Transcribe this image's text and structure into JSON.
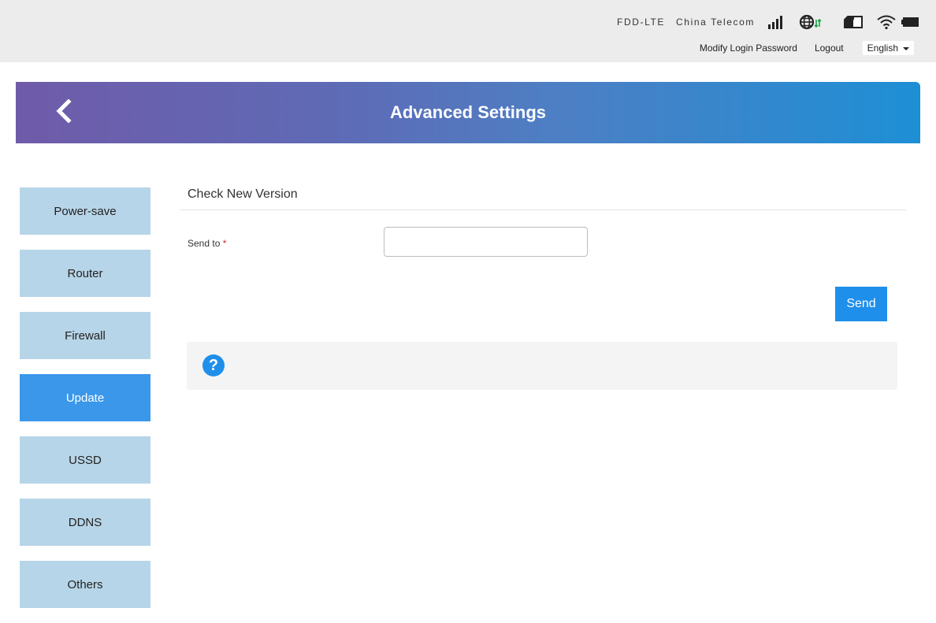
{
  "status": {
    "network_type": "FDD-LTE",
    "carrier": "China Telecom",
    "icons": [
      "signal-bars-icon",
      "globe-data-icon",
      "sim-card-icon",
      "wifi-icon",
      "battery-icon"
    ]
  },
  "header_links": {
    "modify_password": "Modify Login Password",
    "logout": "Logout",
    "language": "English"
  },
  "banner": {
    "title": "Advanced Settings"
  },
  "sidebar": {
    "items": [
      {
        "label": "Power-save",
        "active": false
      },
      {
        "label": "Router",
        "active": false
      },
      {
        "label": "Firewall",
        "active": false
      },
      {
        "label": "Update",
        "active": true
      },
      {
        "label": "USSD",
        "active": false
      },
      {
        "label": "DDNS",
        "active": false
      },
      {
        "label": "Others",
        "active": false
      }
    ]
  },
  "main": {
    "section_title": "Check New Version",
    "send_to_label": "Send to",
    "required_mark": "*",
    "send_to_value": "",
    "send_button": "Send",
    "help_symbol": "?"
  },
  "colors": {
    "accent": "#1e8fea",
    "sidebar_item": "#b7d5e8",
    "sidebar_active": "#3a97ea",
    "banner_start": "#6f5ba9",
    "banner_end": "#1e8fd5",
    "topbar": "#ececec"
  }
}
